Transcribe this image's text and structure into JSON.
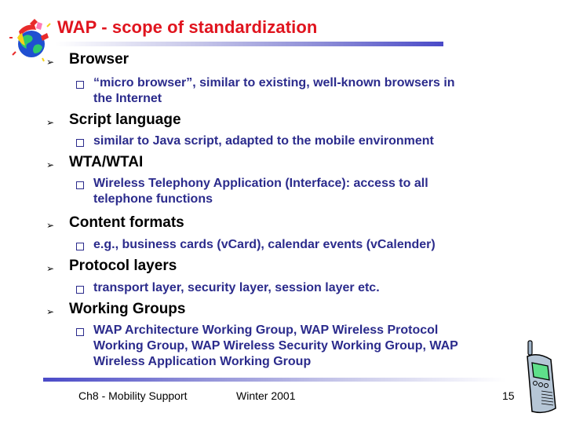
{
  "slide": {
    "title": "WAP - scope of standardization",
    "logo_icon": "globe-logo-icon",
    "phone_icon": "mobile-phone-icon",
    "accent_color": "#e0141e",
    "subtext_color": "#2b2b8c",
    "rule_color": "#4a4ac8"
  },
  "bullets": [
    {
      "heading": "Browser",
      "sub": [
        "“micro browser”, similar to existing, well-known browsers in",
        "the Internet"
      ]
    },
    {
      "heading": "Script language",
      "sub": [
        "similar to Java script, adapted to the mobile environment"
      ]
    },
    {
      "heading": "WTA/WTAI",
      "sub": [
        "Wireless Telephony Application (Interface): access to all",
        "telephone functions"
      ]
    },
    {
      "heading": "Content formats",
      "sub": [
        "e.g., business cards (vCard), calendar events (vCalender)"
      ]
    },
    {
      "heading": "Protocol layers",
      "sub": [
        "transport layer, security layer, session layer etc."
      ]
    },
    {
      "heading": "Working Groups",
      "sub": [
        "WAP Architecture Working Group, WAP Wireless Protocol",
        "Working Group, WAP Wireless Security Working Group, WAP",
        "Wireless Application Working Group"
      ]
    }
  ],
  "footer": {
    "left": "Ch8 - Mobility Support",
    "center": "Winter 2001",
    "page": "15"
  },
  "glyphs": {
    "l1_bullet": "➢"
  }
}
